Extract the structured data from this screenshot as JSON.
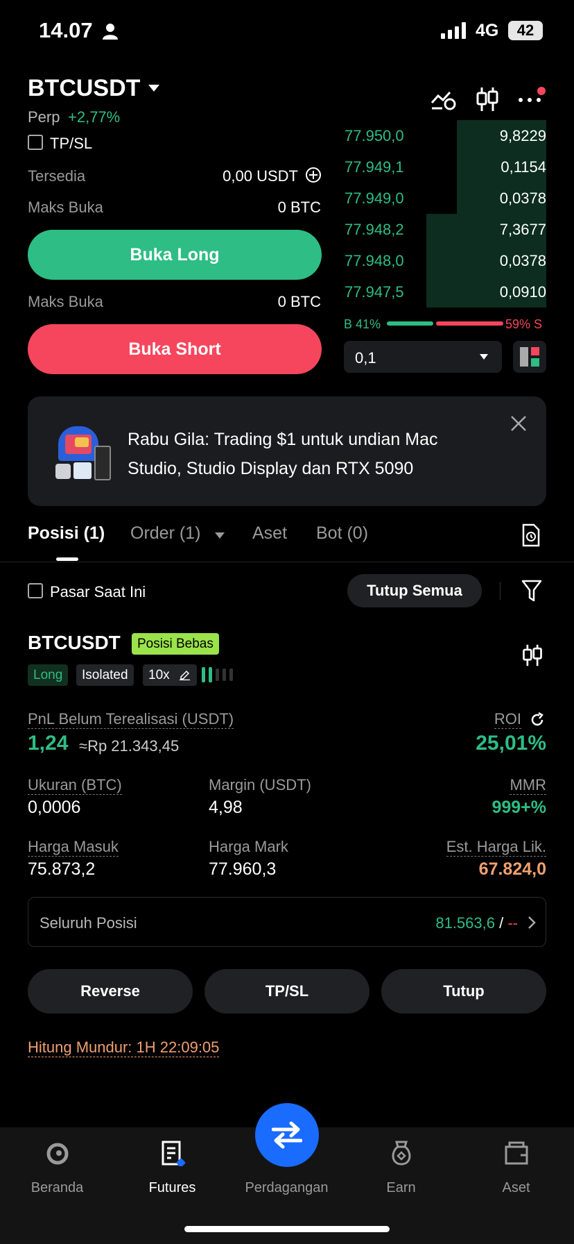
{
  "status_bar": {
    "time": "14.07",
    "network": "4G",
    "battery": "42"
  },
  "header": {
    "pair": "BTCUSDT",
    "contract_type": "Perp",
    "change": "+2,77%"
  },
  "order_form": {
    "tpsl_label": "TP/SL",
    "available_label": "Tersedia",
    "available_value": "0,00 USDT",
    "max_open_label": "Maks Buka",
    "max_open_long": "0 BTC",
    "open_long_label": "Buka Long",
    "max_open_short": "0 BTC",
    "open_short_label": "Buka Short"
  },
  "orderbook": {
    "rows": [
      {
        "price": "77.950,0",
        "qty": "9,8229",
        "depth": 0.44
      },
      {
        "price": "77.949,1",
        "qty": "0,1154",
        "depth": 0.44
      },
      {
        "price": "77.949,0",
        "qty": "0,0378",
        "depth": 0.44
      },
      {
        "price": "77.948,2",
        "qty": "7,3677",
        "depth": 0.59
      },
      {
        "price": "77.948,0",
        "qty": "0,0378",
        "depth": 0.59
      },
      {
        "price": "77.947,5",
        "qty": "0,0910",
        "depth": 0.59
      }
    ],
    "buy_ratio_label": "B 41%",
    "sell_ratio_label": "59% S",
    "buy_ratio": 0.41,
    "precision": "0,1"
  },
  "banner": {
    "text": "Rabu Gila: Trading $1 untuk undian Mac Studio, Studio Display dan RTX 5090"
  },
  "tabs": [
    {
      "label": "Posisi (1)"
    },
    {
      "label": "Order (1)"
    },
    {
      "label": "Aset"
    },
    {
      "label": "Bot (0)"
    }
  ],
  "filters": {
    "current_market_label": "Pasar Saat Ini",
    "close_all_label": "Tutup Semua"
  },
  "position": {
    "symbol": "BTCUSDT",
    "badge": "Posisi Bebas",
    "side": "Long",
    "margin_mode": "Isolated",
    "leverage": "10x",
    "pnl_label": "PnL Belum Terealisasi (USDT)",
    "pnl_value": "1,24",
    "pnl_idr": "≈Rp 21.343,45",
    "roi_label": "ROI",
    "roi_value": "25,01%",
    "size_label": "Ukuran (BTC)",
    "size_value": "0,0006",
    "margin_label": "Margin (USDT)",
    "margin_value": "4,98",
    "mmr_label": "MMR",
    "mmr_value": "999+%",
    "entry_label": "Harga Masuk",
    "entry_value": "75.873,2",
    "mark_label": "Harga Mark",
    "mark_value": "77.960,3",
    "liq_label": "Est. Harga Lik.",
    "liq_value": "67.824,0",
    "all_positions_label": "Seluruh Posisi",
    "all_positions_value": "81.563,6",
    "all_positions_sep": "/",
    "all_positions_tail": "--",
    "reverse_label": "Reverse",
    "tpsl_label": "TP/SL",
    "close_label": "Tutup",
    "countdown": "Hitung Mundur: 1H 22:09:05"
  },
  "nav": [
    {
      "label": "Beranda"
    },
    {
      "label": "Futures"
    },
    {
      "label": "Perdagangan"
    },
    {
      "label": "Earn"
    },
    {
      "label": "Aset"
    }
  ]
}
